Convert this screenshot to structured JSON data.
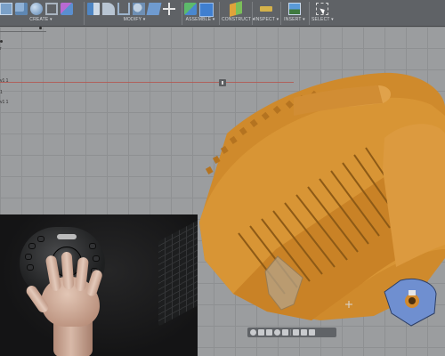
{
  "toolbar": {
    "groups": [
      {
        "label": "CREATE ▾",
        "icons": [
          "sketch-icon",
          "box-icon",
          "sphere-icon",
          "frame-icon",
          "form-icon"
        ]
      },
      {
        "label": "MODIFY ▾",
        "icons": [
          "press-pull-icon",
          "fillet-icon",
          "shell-icon",
          "combine-icon",
          "align-icon",
          "move-icon"
        ]
      },
      {
        "label": "ASSEMBLE ▾",
        "icons": [
          "new-component-icon",
          "joint-icon"
        ]
      },
      {
        "label": "CONSTRUCT ▾",
        "icons": [
          "offset-plane-icon"
        ]
      },
      {
        "label": "INSPECT ▾",
        "icons": [
          "measure-icon"
        ]
      },
      {
        "label": "INSERT ▾",
        "icons": [
          "insert-image-icon"
        ]
      },
      {
        "label": "SELECT ▾",
        "icons": [
          "select-icon"
        ]
      }
    ]
  },
  "browser": {
    "items": [
      {
        "label": "r"
      },
      {
        "label": "v1 1"
      },
      {
        "label": "1"
      },
      {
        "label": "v1 1"
      }
    ]
  },
  "navbar": {
    "icons": [
      "orbit-icon",
      "pan-icon",
      "look-at-icon",
      "zoom-icon",
      "fit-icon",
      "display-settings-icon",
      "grid-icon",
      "viewports-icon"
    ]
  },
  "colors": {
    "part_fill": "#d48f2f",
    "part_shadow": "#a86a1b",
    "part_highlight": "#e8ac52",
    "selected_face": "#6f8fd0",
    "grid_bg": "#9b9d9f"
  },
  "video": {
    "description_icon": "spacemouse-device"
  }
}
